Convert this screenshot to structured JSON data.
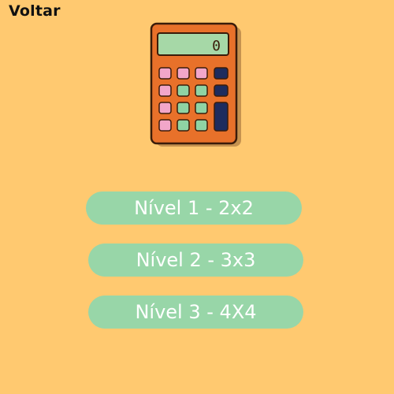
{
  "header": {
    "back_label": "Voltar"
  },
  "illustration": {
    "icon": "calculator-icon",
    "display_text": "0"
  },
  "levels": [
    {
      "label": "Nível 1 - 2x2"
    },
    {
      "label": "Nível 2 - 3x3"
    },
    {
      "label": "Nível 3 - 4X4"
    }
  ],
  "colors": {
    "background": "#FFC970",
    "button": "#98D6A8",
    "button_text": "#FFFFFF",
    "calculator_body": "#E8712A",
    "calculator_screen": "#A6D8A7",
    "key_pink": "#F2A6C9",
    "key_green": "#8FD3A4",
    "key_navy": "#1E2C5E"
  }
}
